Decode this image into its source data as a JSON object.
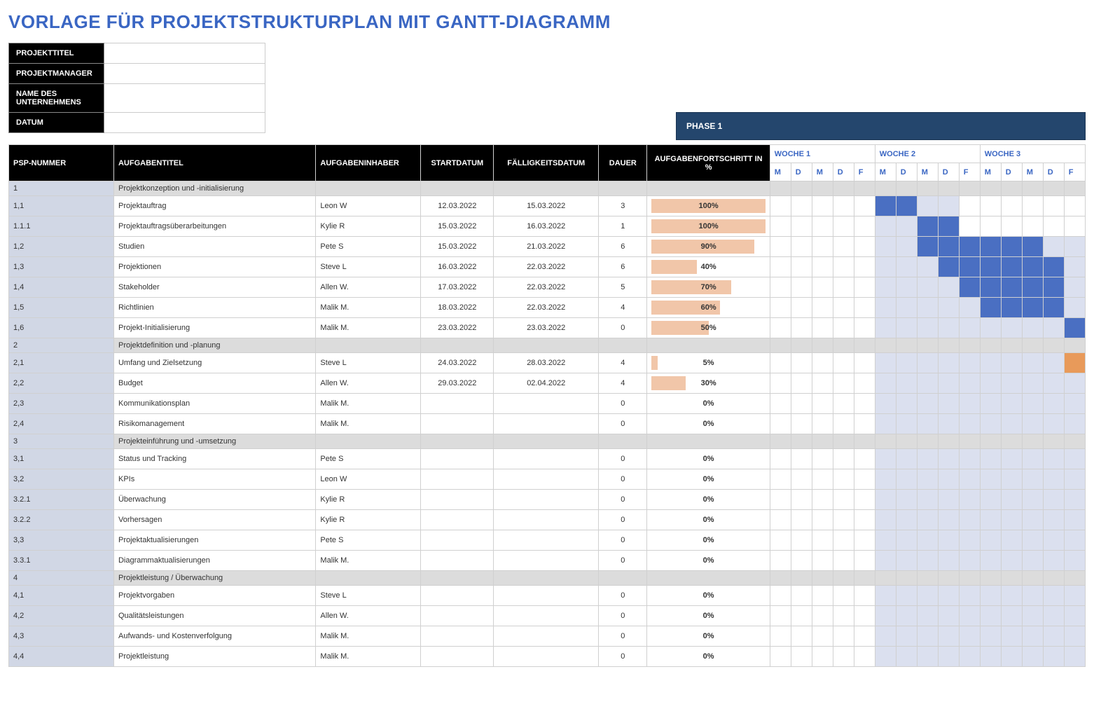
{
  "title": "VORLAGE FÜR PROJEKTSTRUKTURPLAN MIT GANTT-DIAGRAMM",
  "meta": {
    "projekttitel_label": "PROJEKTTITEL",
    "projektmanager_label": "PROJEKTMANAGER",
    "unternehmen_label": "NAME DES UNTERNEHMENS",
    "datum_label": "DATUM",
    "projekttitel": "",
    "projektmanager": "",
    "unternehmen": "",
    "datum": ""
  },
  "phase_label": "PHASE 1",
  "headers": {
    "wbs": "PSP-NUMMER",
    "title": "AUFGABENTITEL",
    "owner": "AUFGABENINHABER",
    "start": "STARTDATUM",
    "due": "FÄLLIGKEITSDATUM",
    "duration": "DAUER",
    "progress": "AUFGABENFORTSCHRITT IN %"
  },
  "weeks": [
    {
      "label": "WOCHE 1",
      "days": [
        "M",
        "D",
        "M",
        "D",
        "F"
      ]
    },
    {
      "label": "WOCHE 2",
      "days": [
        "M",
        "D",
        "M",
        "D",
        "F"
      ]
    },
    {
      "label": "WOCHE 3",
      "days": [
        "M",
        "D",
        "M",
        "D",
        "F"
      ]
    }
  ],
  "rows": [
    {
      "wbs": "1",
      "title": "Projektkonzeption und -initialisierung",
      "section": true
    },
    {
      "wbs": "1,1",
      "title": "Projektauftrag",
      "owner": "Leon W",
      "start": "12.03.2022",
      "due": "15.03.2022",
      "dur": "3",
      "prog": 100,
      "bars": [
        0,
        0,
        0,
        0,
        0,
        2,
        2,
        1,
        1,
        0,
        0,
        0,
        0,
        0,
        0
      ]
    },
    {
      "wbs": "1.1.1",
      "title": "Projektauftragsüberarbeitungen",
      "owner": "Kylie R",
      "start": "15.03.2022",
      "due": "16.03.2022",
      "dur": "1",
      "prog": 100,
      "bars": [
        0,
        0,
        0,
        0,
        0,
        1,
        1,
        2,
        2,
        0,
        0,
        0,
        0,
        0,
        0
      ]
    },
    {
      "wbs": "1,2",
      "title": "Studien",
      "owner": "Pete S",
      "start": "15.03.2022",
      "due": "21.03.2022",
      "dur": "6",
      "prog": 90,
      "bars": [
        0,
        0,
        0,
        0,
        0,
        1,
        1,
        2,
        2,
        2,
        2,
        2,
        2,
        1,
        1
      ]
    },
    {
      "wbs": "1,3",
      "title": "Projektionen",
      "owner": "Steve L",
      "start": "16.03.2022",
      "due": "22.03.2022",
      "dur": "6",
      "prog": 40,
      "bars": [
        0,
        0,
        0,
        0,
        0,
        1,
        1,
        1,
        2,
        2,
        2,
        2,
        2,
        2,
        1
      ]
    },
    {
      "wbs": "1,4",
      "title": "Stakeholder",
      "owner": "Allen W.",
      "start": "17.03.2022",
      "due": "22.03.2022",
      "dur": "5",
      "prog": 70,
      "bars": [
        0,
        0,
        0,
        0,
        0,
        1,
        1,
        1,
        1,
        2,
        2,
        2,
        2,
        2,
        1
      ]
    },
    {
      "wbs": "1,5",
      "title": "Richtlinien",
      "owner": "Malik M.",
      "start": "18.03.2022",
      "due": "22.03.2022",
      "dur": "4",
      "prog": 60,
      "bars": [
        0,
        0,
        0,
        0,
        0,
        1,
        1,
        1,
        1,
        1,
        2,
        2,
        2,
        2,
        1
      ]
    },
    {
      "wbs": "1,6",
      "title": "Projekt-Initialisierung",
      "owner": "Malik M.",
      "start": "23.03.2022",
      "due": "23.03.2022",
      "dur": "0",
      "prog": 50,
      "bars": [
        0,
        0,
        0,
        0,
        0,
        1,
        1,
        1,
        1,
        1,
        1,
        1,
        1,
        1,
        2
      ]
    },
    {
      "wbs": "2",
      "title": "Projektdefinition und -planung",
      "section": true
    },
    {
      "wbs": "2,1",
      "title": "Umfang und Zielsetzung",
      "owner": "Steve L",
      "start": "24.03.2022",
      "due": "28.03.2022",
      "dur": "4",
      "prog": 5,
      "bars": [
        0,
        0,
        0,
        0,
        0,
        1,
        1,
        1,
        1,
        1,
        1,
        1,
        1,
        1,
        3
      ]
    },
    {
      "wbs": "2,2",
      "title": "Budget",
      "owner": "Allen W.",
      "start": "29.03.2022",
      "due": "02.04.2022",
      "dur": "4",
      "prog": 30,
      "bars": [
        0,
        0,
        0,
        0,
        0,
        1,
        1,
        1,
        1,
        1,
        1,
        1,
        1,
        1,
        1
      ]
    },
    {
      "wbs": "2,3",
      "title": "Kommunikationsplan",
      "owner": "Malik M.",
      "start": "",
      "due": "",
      "dur": "0",
      "prog": 0,
      "bars": [
        0,
        0,
        0,
        0,
        0,
        1,
        1,
        1,
        1,
        1,
        1,
        1,
        1,
        1,
        1
      ]
    },
    {
      "wbs": "2,4",
      "title": "Risikomanagement",
      "owner": "Malik M.",
      "start": "",
      "due": "",
      "dur": "0",
      "prog": 0,
      "bars": [
        0,
        0,
        0,
        0,
        0,
        1,
        1,
        1,
        1,
        1,
        1,
        1,
        1,
        1,
        1
      ]
    },
    {
      "wbs": "3",
      "title": "Projekteinführung und -umsetzung",
      "section": true
    },
    {
      "wbs": "3,1",
      "title": "Status und Tracking",
      "owner": "Pete S",
      "start": "",
      "due": "",
      "dur": "0",
      "prog": 0,
      "bars": [
        0,
        0,
        0,
        0,
        0,
        1,
        1,
        1,
        1,
        1,
        1,
        1,
        1,
        1,
        1
      ]
    },
    {
      "wbs": "3,2",
      "title": "KPIs",
      "owner": "Leon W",
      "start": "",
      "due": "",
      "dur": "0",
      "prog": 0,
      "bars": [
        0,
        0,
        0,
        0,
        0,
        1,
        1,
        1,
        1,
        1,
        1,
        1,
        1,
        1,
        1
      ]
    },
    {
      "wbs": "3.2.1",
      "title": "Überwachung",
      "owner": "Kylie R",
      "start": "",
      "due": "",
      "dur": "0",
      "prog": 0,
      "bars": [
        0,
        0,
        0,
        0,
        0,
        1,
        1,
        1,
        1,
        1,
        1,
        1,
        1,
        1,
        1
      ]
    },
    {
      "wbs": "3.2.2",
      "title": "Vorhersagen",
      "owner": "Kylie R",
      "start": "",
      "due": "",
      "dur": "0",
      "prog": 0,
      "bars": [
        0,
        0,
        0,
        0,
        0,
        1,
        1,
        1,
        1,
        1,
        1,
        1,
        1,
        1,
        1
      ]
    },
    {
      "wbs": "3,3",
      "title": "Projektaktualisierungen",
      "owner": "Pete S",
      "start": "",
      "due": "",
      "dur": "0",
      "prog": 0,
      "bars": [
        0,
        0,
        0,
        0,
        0,
        1,
        1,
        1,
        1,
        1,
        1,
        1,
        1,
        1,
        1
      ]
    },
    {
      "wbs": "3.3.1",
      "title": "Diagrammaktualisierungen",
      "owner": "Malik M.",
      "start": "",
      "due": "",
      "dur": "0",
      "prog": 0,
      "bars": [
        0,
        0,
        0,
        0,
        0,
        1,
        1,
        1,
        1,
        1,
        1,
        1,
        1,
        1,
        1
      ]
    },
    {
      "wbs": "4",
      "title": "Projektleistung / Überwachung",
      "section": true
    },
    {
      "wbs": "4,1",
      "title": "Projektvorgaben",
      "owner": "Steve L",
      "start": "",
      "due": "",
      "dur": "0",
      "prog": 0,
      "bars": [
        0,
        0,
        0,
        0,
        0,
        1,
        1,
        1,
        1,
        1,
        1,
        1,
        1,
        1,
        1
      ]
    },
    {
      "wbs": "4,2",
      "title": "Qualitätsleistungen",
      "owner": "Allen W.",
      "start": "",
      "due": "",
      "dur": "0",
      "prog": 0,
      "bars": [
        0,
        0,
        0,
        0,
        0,
        1,
        1,
        1,
        1,
        1,
        1,
        1,
        1,
        1,
        1
      ]
    },
    {
      "wbs": "4,3",
      "title": "Aufwands- und Kostenverfolgung",
      "owner": "Malik M.",
      "start": "",
      "due": "",
      "dur": "0",
      "prog": 0,
      "bars": [
        0,
        0,
        0,
        0,
        0,
        1,
        1,
        1,
        1,
        1,
        1,
        1,
        1,
        1,
        1
      ]
    },
    {
      "wbs": "4,4",
      "title": "Projektleistung",
      "owner": "Malik M.",
      "start": "",
      "due": "",
      "dur": "0",
      "prog": 0,
      "bars": [
        0,
        0,
        0,
        0,
        0,
        1,
        1,
        1,
        1,
        1,
        1,
        1,
        1,
        1,
        1
      ]
    }
  ],
  "chart_data": {
    "type": "bar",
    "title": "Aufgabenfortschritt in %",
    "categories": [
      "1,1",
      "1.1.1",
      "1,2",
      "1,3",
      "1,4",
      "1,5",
      "1,6",
      "2,1",
      "2,2",
      "2,3",
      "2,4",
      "3,1",
      "3,2",
      "3.2.1",
      "3.2.2",
      "3,3",
      "3.3.1",
      "4,1",
      "4,2",
      "4,3",
      "4,4"
    ],
    "values": [
      100,
      100,
      90,
      40,
      70,
      60,
      50,
      5,
      30,
      0,
      0,
      0,
      0,
      0,
      0,
      0,
      0,
      0,
      0,
      0,
      0
    ],
    "xlabel": "",
    "ylabel": "%",
    "ylim": [
      0,
      100
    ]
  }
}
